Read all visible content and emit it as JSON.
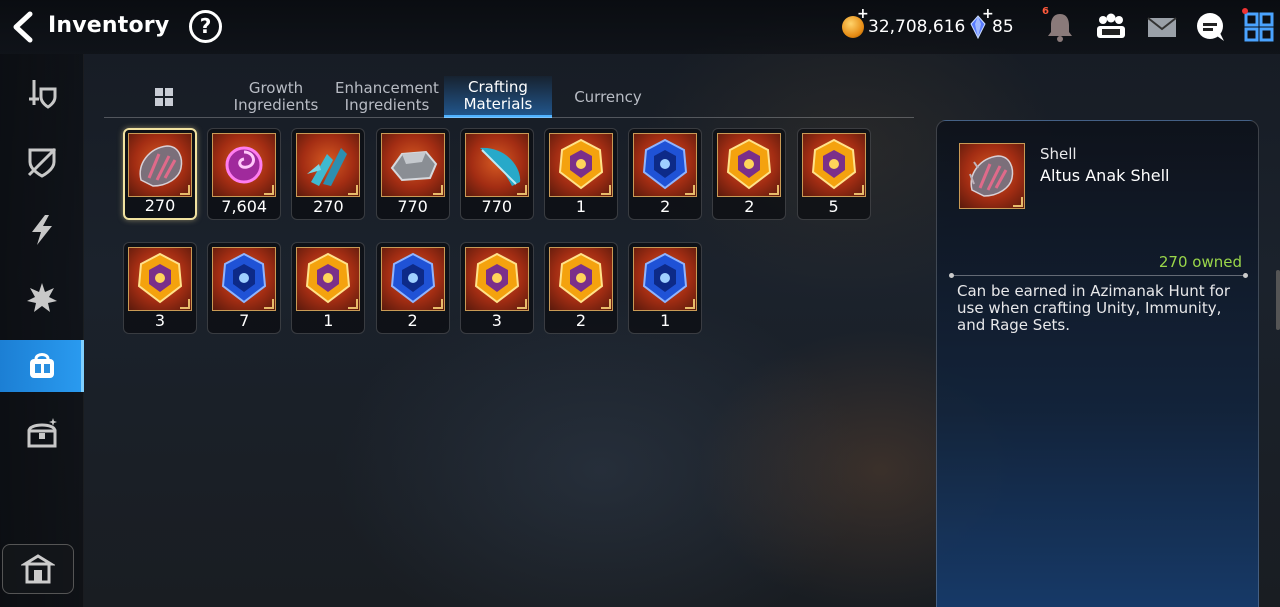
{
  "header": {
    "title": "Inventory",
    "help_label": "?",
    "gold": "32,708,616",
    "crystals": "85",
    "notification_count": "6"
  },
  "sidebar": {
    "items": [
      {
        "name": "sidebar-item-equipment",
        "icon": "sword-shield-icon"
      },
      {
        "name": "sidebar-item-artifacts",
        "icon": "broken-shield-icon"
      },
      {
        "name": "sidebar-item-skills",
        "icon": "lightning-icon"
      },
      {
        "name": "sidebar-item-catalysts",
        "icon": "star-burst-icon"
      },
      {
        "name": "sidebar-item-materials",
        "icon": "bag-icon",
        "active": true
      },
      {
        "name": "sidebar-item-chests",
        "icon": "chest-icon"
      }
    ]
  },
  "tabs": [
    {
      "line1": "Growth",
      "line2": "Ingredients"
    },
    {
      "line1": "Enhancement",
      "line2": "Ingredients"
    },
    {
      "line1": "Crafting",
      "line2": "Materials",
      "active": true
    },
    {
      "line1": "Currency",
      "line2": ""
    }
  ],
  "items": [
    {
      "type": "shell",
      "qty": "270"
    },
    {
      "type": "swirl",
      "qty": "7,604"
    },
    {
      "type": "crystal-claw",
      "qty": "270"
    },
    {
      "type": "ore",
      "qty": "770"
    },
    {
      "type": "feather",
      "qty": "770"
    },
    {
      "type": "rune-gold",
      "qty": "1"
    },
    {
      "type": "rune-blue",
      "qty": "2"
    },
    {
      "type": "rune-gold",
      "qty": "2"
    },
    {
      "type": "rune-gold",
      "qty": "5"
    },
    {
      "type": "rune-gold",
      "qty": "3"
    },
    {
      "type": "rune-blue",
      "qty": "7"
    },
    {
      "type": "rune-gold",
      "qty": "1"
    },
    {
      "type": "rune-blue",
      "qty": "2"
    },
    {
      "type": "rune-gold",
      "qty": "3"
    },
    {
      "type": "rune-gold",
      "qty": "2"
    },
    {
      "type": "rune-blue",
      "qty": "1"
    }
  ],
  "detail": {
    "category": "Shell",
    "name": "Altus Anak Shell",
    "owned": "270 owned",
    "description": "Can be earned in Azimanak Hunt for use when crafting Unity, Immunity, and Rage Sets."
  },
  "colors": {
    "accent": "#2a9bf0",
    "owned_green": "#9ad64a",
    "selected_border": "#f1e2a0"
  }
}
